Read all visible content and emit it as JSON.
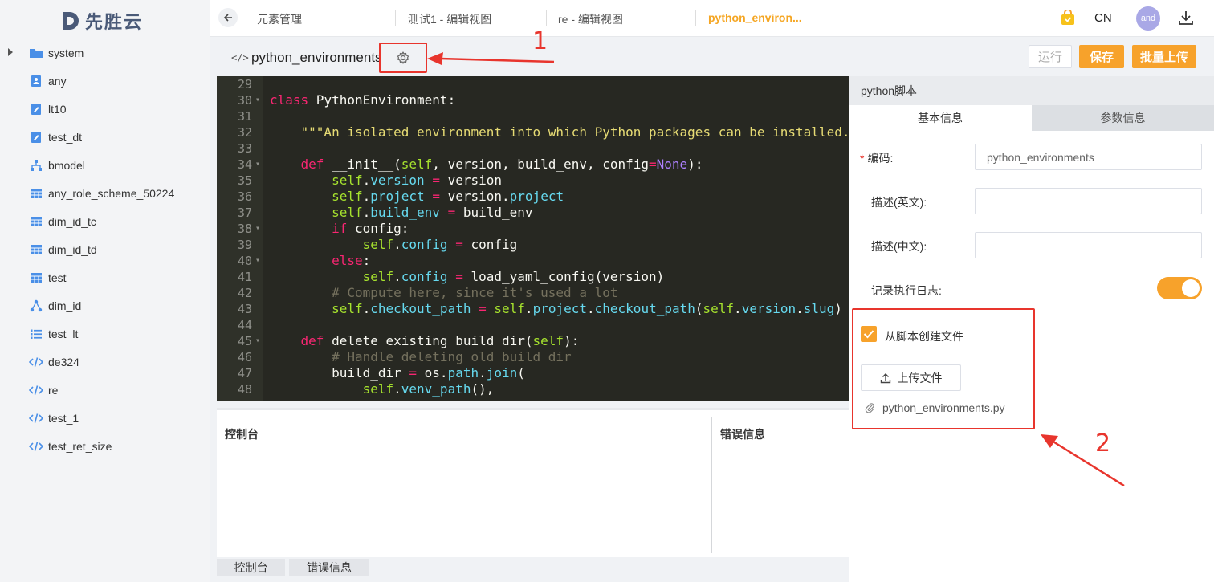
{
  "brand": {
    "name": "先胜云"
  },
  "sidebar": {
    "items": [
      {
        "label": "system",
        "icon": "folder-icon",
        "expandable": true
      },
      {
        "label": "any",
        "icon": "user-doc-icon"
      },
      {
        "label": "lt10",
        "icon": "edit-doc-icon"
      },
      {
        "label": "test_dt",
        "icon": "edit-doc-icon"
      },
      {
        "label": "bmodel",
        "icon": "hierarchy-icon"
      },
      {
        "label": "any_role_scheme_50224",
        "icon": "table-icon"
      },
      {
        "label": "dim_id_tc",
        "icon": "table-icon"
      },
      {
        "label": "dim_id_td",
        "icon": "table-icon"
      },
      {
        "label": "test",
        "icon": "table-icon"
      },
      {
        "label": "dim_id",
        "icon": "graph-icon"
      },
      {
        "label": "test_lt",
        "icon": "list-icon"
      },
      {
        "label": "de324",
        "icon": "code-icon"
      },
      {
        "label": "re",
        "icon": "code-icon"
      },
      {
        "label": "test_1",
        "icon": "code-icon"
      },
      {
        "label": "test_ret_size",
        "icon": "code-icon"
      }
    ]
  },
  "topbar": {
    "tabs": [
      {
        "label": "元素管理"
      },
      {
        "label": "测试1 - 编辑视图"
      },
      {
        "label": "re - 编辑视图"
      },
      {
        "label": "python_environ...",
        "active": true
      }
    ],
    "lang": "CN",
    "avatar": "and"
  },
  "script": {
    "code_icon": "</>",
    "title": "python_environments",
    "buttons": {
      "run": "运行",
      "save": "保存",
      "batch_upload": "批量上传"
    }
  },
  "annotations": {
    "first": "1",
    "second": "2"
  },
  "editor": {
    "lines": [
      {
        "n": "29",
        "fold": false,
        "html": ""
      },
      {
        "n": "30",
        "fold": true,
        "html": "<span class=\"kw\">class</span> PythonEnvironment:"
      },
      {
        "n": "31",
        "fold": false,
        "html": ""
      },
      {
        "n": "32",
        "fold": false,
        "html": "    <span class=\"str\">\"\"\"An isolated environment into which Python packages can be installed.</span>"
      },
      {
        "n": "33",
        "fold": false,
        "html": ""
      },
      {
        "n": "34",
        "fold": true,
        "html": "    <span class=\"kw\">def</span> __init__(<span class=\"sf\">self</span>, version, build_env, config<span class=\"kw\">=</span><span class=\"pu\">None</span>):"
      },
      {
        "n": "35",
        "fold": false,
        "html": "        <span class=\"sf\">self</span>.<span class=\"bl\">version</span> <span class=\"kw\">=</span> version"
      },
      {
        "n": "36",
        "fold": false,
        "html": "        <span class=\"sf\">self</span>.<span class=\"bl\">project</span> <span class=\"kw\">=</span> version.<span class=\"bl\">project</span>"
      },
      {
        "n": "37",
        "fold": false,
        "html": "        <span class=\"sf\">self</span>.<span class=\"bl\">build_env</span> <span class=\"kw\">=</span> build_env"
      },
      {
        "n": "38",
        "fold": true,
        "html": "        <span class=\"kw\">if</span> config:"
      },
      {
        "n": "39",
        "fold": false,
        "html": "            <span class=\"sf\">self</span>.<span class=\"bl\">config</span> <span class=\"kw\">=</span> config"
      },
      {
        "n": "40",
        "fold": true,
        "html": "        <span class=\"kw\">else</span>:"
      },
      {
        "n": "41",
        "fold": false,
        "html": "            <span class=\"sf\">self</span>.<span class=\"bl\">config</span> <span class=\"kw\">=</span> load_yaml_config(version)"
      },
      {
        "n": "42",
        "fold": false,
        "html": "        <span class=\"cm\"># Compute here, since it's used a lot</span>"
      },
      {
        "n": "43",
        "fold": false,
        "html": "        <span class=\"sf\">self</span>.<span class=\"bl\">checkout_path</span> <span class=\"kw\">=</span> <span class=\"sf\">self</span>.<span class=\"bl\">project</span>.<span class=\"bl\">checkout_path</span>(<span class=\"sf\">self</span>.<span class=\"bl\">version</span>.<span class=\"bl\">slug</span>)"
      },
      {
        "n": "44",
        "fold": false,
        "html": ""
      },
      {
        "n": "45",
        "fold": true,
        "html": "    <span class=\"kw\">def</span> delete_existing_build_dir(<span class=\"sf\">self</span>):"
      },
      {
        "n": "46",
        "fold": false,
        "html": "        <span class=\"cm\"># Handle deleting old build dir</span>"
      },
      {
        "n": "47",
        "fold": false,
        "html": "        build_dir <span class=\"kw\">=</span> os.<span class=\"bl\">path</span>.<span class=\"bl\">join</span>("
      },
      {
        "n": "48",
        "fold": false,
        "html": "            <span class=\"sf\">self</span>.<span class=\"bl\">venv_path</span>(),"
      }
    ]
  },
  "console": {
    "console_label": "控制台",
    "error_label": "错误信息"
  },
  "bottom_tabs": {
    "console": "控制台",
    "errors": "错误信息"
  },
  "panel": {
    "header": "python脚本",
    "tabs": {
      "basic": "基本信息",
      "params": "参数信息"
    },
    "fields": {
      "code_label": "编码:",
      "code_value": "python_environments",
      "desc_en_label": "描述(英文):",
      "desc_en_value": "",
      "desc_cn_label": "描述(中文):",
      "desc_cn_value": "",
      "log_label": "记录执行日志:"
    },
    "log_enabled": true,
    "create_from_script_label": "从脚本创建文件",
    "create_from_script_checked": true,
    "upload_label": "上传文件",
    "file_name": "python_environments.py"
  },
  "colors": {
    "accent": "#f7a22b",
    "annotation": "#e8352d",
    "editor_bg": "#272822"
  }
}
